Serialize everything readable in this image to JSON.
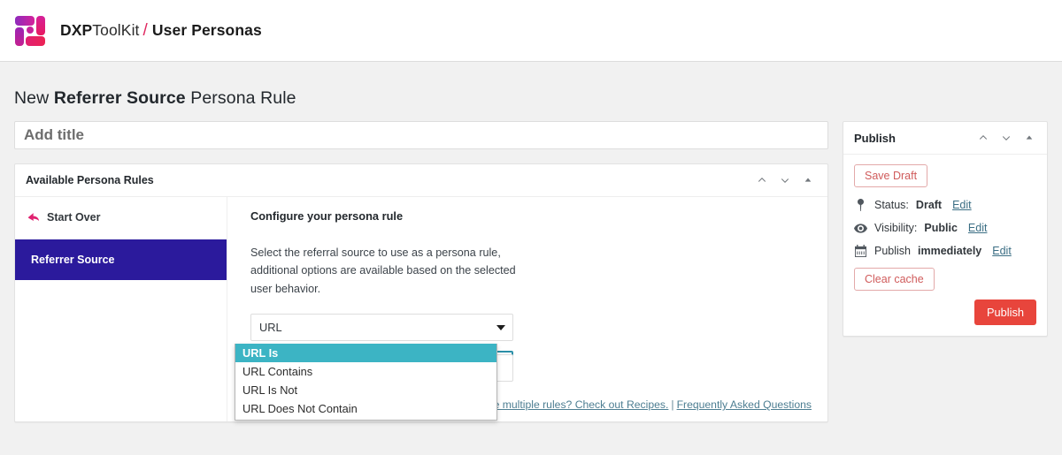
{
  "brand": {
    "logo_icon": "dxp-toolkit-logo",
    "name_bold": "DXP",
    "name_light": "ToolKit",
    "separator": "/",
    "section": "User Personas"
  },
  "page": {
    "title_prefix": "New ",
    "title_bold": "Referrer Source",
    "title_suffix": " Persona Rule",
    "title_input_value": "",
    "title_input_placeholder": "Add title"
  },
  "rules_panel": {
    "header": "Available Persona Rules",
    "collapse_up_icon": "chevron-up-icon",
    "collapse_down_icon": "chevron-down-icon",
    "toggle_icon": "caret-up-icon",
    "nav": {
      "start_over": "Start Over",
      "start_over_icon": "arrow-back-icon",
      "items": [
        {
          "label": "Referrer Source",
          "selected": true
        }
      ]
    },
    "config": {
      "heading": "Configure your persona rule",
      "description": "Select the referral source to use as a persona rule, additional options are available based on the selected user behavior.",
      "source_select": {
        "value": "URL",
        "caret_icon": "caret-down-icon"
      },
      "condition_select": {
        "value": "URL Is",
        "caret_icon": "caret-down-icon",
        "focused": true,
        "options": [
          {
            "label": "URL Is",
            "highlighted": true
          },
          {
            "label": "URL Contains",
            "highlighted": false
          },
          {
            "label": "URL Is Not",
            "highlighted": false
          },
          {
            "label": "URL Does Not Contain",
            "highlighted": false
          }
        ]
      },
      "value_input": ""
    },
    "footer": {
      "recipes_link": "nbine multiple rules? Check out Recipes.",
      "separator": "|",
      "faq_link": "Frequently Asked Questions"
    }
  },
  "publish_panel": {
    "header": "Publish",
    "collapse_up_icon": "chevron-up-icon",
    "collapse_down_icon": "chevron-down-icon",
    "toggle_icon": "caret-up-icon",
    "save_draft_label": "Save Draft",
    "status_rows": [
      {
        "icon": "pin-icon",
        "label": "Status:",
        "value": "Draft",
        "edit": "Edit"
      },
      {
        "icon": "eye-icon",
        "label": "Visibility:",
        "value": "Public",
        "edit": "Edit"
      },
      {
        "icon": "calendar-icon",
        "label": "Publish",
        "value": "immediately",
        "edit": "Edit"
      }
    ],
    "clear_cache_label": "Clear cache",
    "publish_label": "Publish"
  },
  "colors": {
    "accent_indigo": "#2b1a9c",
    "accent_pink": "#e0216f",
    "highlight_teal": "#3cb4c4",
    "publish_red": "#e8453c",
    "focus_border": "#2a8fa8"
  }
}
